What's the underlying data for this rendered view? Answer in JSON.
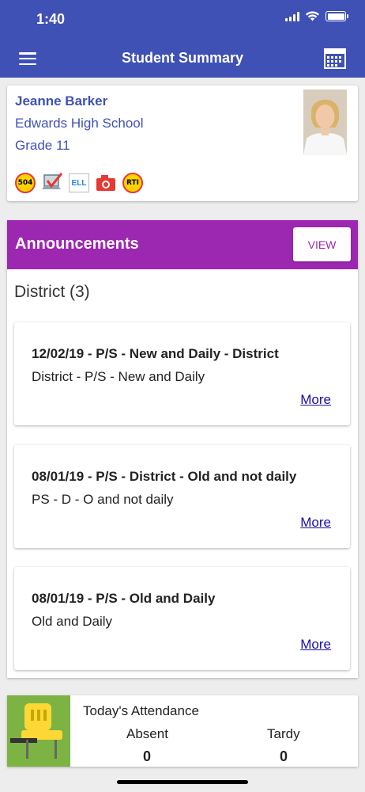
{
  "status_bar": {
    "time": "1:40"
  },
  "header": {
    "title": "Student Summary"
  },
  "student": {
    "name": "Jeanne Barker",
    "school": "Edwards High School",
    "grade": "Grade 11",
    "badges": [
      {
        "label": "504",
        "icon": "504-badge-icon"
      },
      {
        "label": "",
        "icon": "laptop-check-icon"
      },
      {
        "label": "ELL",
        "icon": "ell-badge-icon"
      },
      {
        "label": "",
        "icon": "camera-icon"
      },
      {
        "label": "RTI",
        "icon": "rti-badge-icon"
      }
    ]
  },
  "announcements": {
    "title": "Announcements",
    "view_label": "VIEW",
    "district_heading": "District (3)",
    "items": [
      {
        "title": "12/02/19 - P/S - New and Daily - District",
        "body": "District - P/S - New and Daily",
        "more": "More"
      },
      {
        "title": "08/01/19 - P/S - District - Old and not daily",
        "body": "PS - D - O and not daily",
        "more": "More"
      },
      {
        "title": "08/01/19 - P/S - Old and Daily",
        "body": "Old and Daily",
        "more": "More"
      }
    ]
  },
  "attendance": {
    "title": "Today's Attendance",
    "absent_label": "Absent",
    "absent_value": "0",
    "tardy_label": "Tardy",
    "tardy_value": "0"
  },
  "colors": {
    "header": "#3f51b5",
    "announcements": "#9c27b0",
    "attendance_icon": "#7cb342"
  }
}
